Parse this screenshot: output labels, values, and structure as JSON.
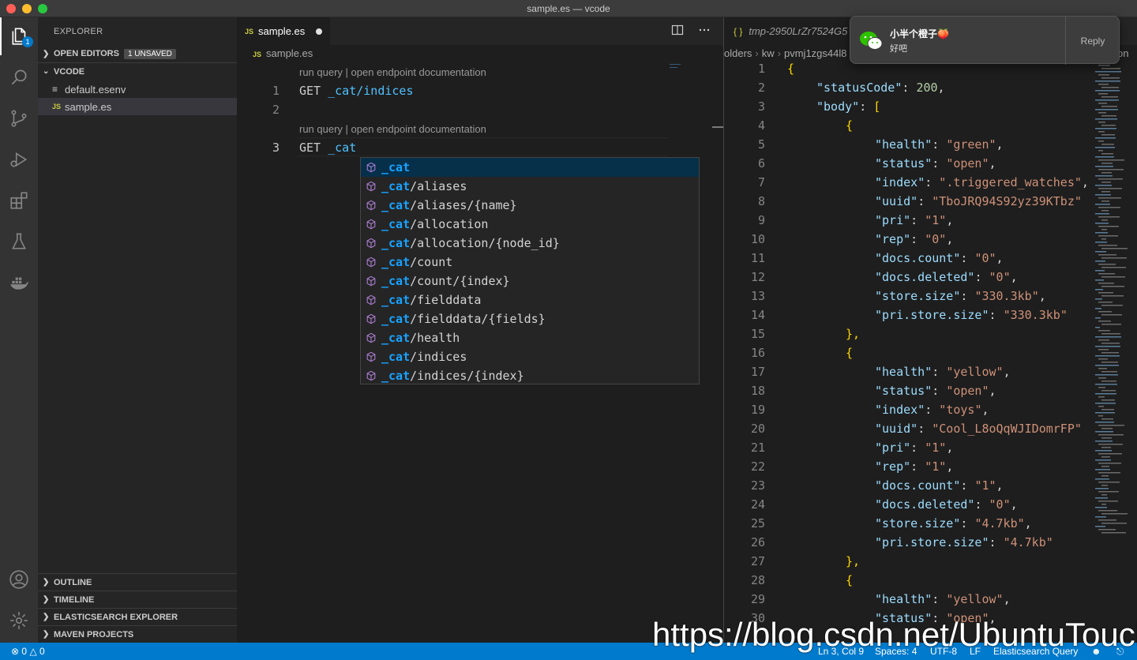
{
  "window": {
    "title": "sample.es — vcode"
  },
  "activity_bar": {
    "items": [
      "files-icon",
      "search-icon",
      "source-control-icon",
      "run-debug-icon",
      "extensions-icon",
      "testing-icon",
      "docker-icon"
    ],
    "explorer_badge": "1",
    "bottom": [
      "account-icon",
      "manage-gear-icon"
    ]
  },
  "sidebar": {
    "title": "EXPLORER",
    "open_editors": {
      "label": "OPEN EDITORS",
      "badge": "1 UNSAVED"
    },
    "workspace": {
      "label": "VCODE"
    },
    "files": [
      {
        "name": "default.esenv",
        "icon": "lines"
      },
      {
        "name": "sample.es",
        "icon": "JS"
      }
    ],
    "bottom_sections": [
      "OUTLINE",
      "TIMELINE",
      "ELASTICSEARCH EXPLORER",
      "MAVEN PROJECTS"
    ]
  },
  "editor1": {
    "tab": {
      "label": "sample.es",
      "icon": "JS"
    },
    "breadcrumb": "sample.es",
    "codelens": "run query | open endpoint documentation",
    "lines": [
      {
        "num": "1",
        "method": "GET",
        "path": "_cat/indices"
      },
      {
        "num": "2",
        "method": "",
        "path": ""
      },
      {
        "num": "3",
        "method": "GET",
        "path": "_cat"
      }
    ],
    "suggestions": [
      {
        "match": "_cat",
        "rest": ""
      },
      {
        "match": "_cat",
        "rest": "/aliases"
      },
      {
        "match": "_cat",
        "rest": "/aliases/{name}"
      },
      {
        "match": "_cat",
        "rest": "/allocation"
      },
      {
        "match": "_cat",
        "rest": "/allocation/{node_id}"
      },
      {
        "match": "_cat",
        "rest": "/count"
      },
      {
        "match": "_cat",
        "rest": "/count/{index}"
      },
      {
        "match": "_cat",
        "rest": "/fielddata"
      },
      {
        "match": "_cat",
        "rest": "/fielddata/{fields}"
      },
      {
        "match": "_cat",
        "rest": "/health"
      },
      {
        "match": "_cat",
        "rest": "/indices"
      },
      {
        "match": "_cat",
        "rest": "/indices/{index}"
      }
    ]
  },
  "editor2": {
    "tab": {
      "label": "tmp-2950LrZr7524G5",
      "icon": "{ }"
    },
    "breadcrumb": [
      "olders",
      "kw",
      "pvmj1zgs44l8"
    ],
    "breadcrumb_tail": "on",
    "json_lines": [
      {
        "n": "1",
        "indent": 0,
        "text": "{"
      },
      {
        "n": "2",
        "indent": 1,
        "key": "statusCode",
        "num": "200",
        "end": ","
      },
      {
        "n": "3",
        "indent": 1,
        "key": "body",
        "raw": "["
      },
      {
        "n": "4",
        "indent": 2,
        "text": "{"
      },
      {
        "n": "5",
        "indent": 3,
        "key": "health",
        "str": "green",
        "end": ","
      },
      {
        "n": "6",
        "indent": 3,
        "key": "status",
        "str": "open",
        "end": ","
      },
      {
        "n": "7",
        "indent": 3,
        "key": "index",
        "str": ".triggered_watches",
        "end": ","
      },
      {
        "n": "8",
        "indent": 3,
        "key": "uuid",
        "str": "TboJRQ94S92yz39KTbz",
        "end": ""
      },
      {
        "n": "9",
        "indent": 3,
        "key": "pri",
        "str": "1",
        "end": ","
      },
      {
        "n": "10",
        "indent": 3,
        "key": "rep",
        "str": "0",
        "end": ","
      },
      {
        "n": "11",
        "indent": 3,
        "key": "docs.count",
        "str": "0",
        "end": ","
      },
      {
        "n": "12",
        "indent": 3,
        "key": "docs.deleted",
        "str": "0",
        "end": ","
      },
      {
        "n": "13",
        "indent": 3,
        "key": "store.size",
        "str": "330.3kb",
        "end": ","
      },
      {
        "n": "14",
        "indent": 3,
        "key": "pri.store.size",
        "str": "330.3kb",
        "end": ""
      },
      {
        "n": "15",
        "indent": 2,
        "text": "},"
      },
      {
        "n": "16",
        "indent": 2,
        "text": "{"
      },
      {
        "n": "17",
        "indent": 3,
        "key": "health",
        "str": "yellow",
        "end": ","
      },
      {
        "n": "18",
        "indent": 3,
        "key": "status",
        "str": "open",
        "end": ","
      },
      {
        "n": "19",
        "indent": 3,
        "key": "index",
        "str": "toys",
        "end": ","
      },
      {
        "n": "20",
        "indent": 3,
        "key": "uuid",
        "str": "Cool_L8oQqWJIDomrFP",
        "end": ""
      },
      {
        "n": "21",
        "indent": 3,
        "key": "pri",
        "str": "1",
        "end": ","
      },
      {
        "n": "22",
        "indent": 3,
        "key": "rep",
        "str": "1",
        "end": ","
      },
      {
        "n": "23",
        "indent": 3,
        "key": "docs.count",
        "str": "1",
        "end": ","
      },
      {
        "n": "24",
        "indent": 3,
        "key": "docs.deleted",
        "str": "0",
        "end": ","
      },
      {
        "n": "25",
        "indent": 3,
        "key": "store.size",
        "str": "4.7kb",
        "end": ","
      },
      {
        "n": "26",
        "indent": 3,
        "key": "pri.store.size",
        "str": "4.7kb",
        "end": ""
      },
      {
        "n": "27",
        "indent": 2,
        "text": "},"
      },
      {
        "n": "28",
        "indent": 2,
        "text": "{"
      },
      {
        "n": "29",
        "indent": 3,
        "key": "health",
        "str": "yellow",
        "end": ","
      },
      {
        "n": "30",
        "indent": 3,
        "key": "status",
        "str": "open",
        "end": ","
      }
    ]
  },
  "notification": {
    "sender": "小半个橙子🍑",
    "message": "好吧",
    "action": "Reply"
  },
  "statusbar": {
    "errors": "0",
    "warnings": "0",
    "position": "Ln 3, Col 9",
    "spaces": "Spaces: 4",
    "encoding": "UTF-8",
    "eol": "LF",
    "language": "Elasticsearch Query"
  },
  "watermark": "https://blog.csdn.net/UbuntuTouch"
}
